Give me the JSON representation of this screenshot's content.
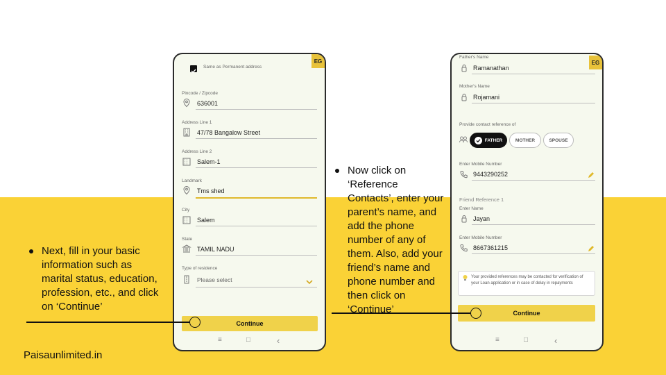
{
  "slide": {
    "left_note": "Next, fill in your basic information such as marital status, education, profession, etc., and click on ‘Continue’",
    "right_note": "Now click on ‘Reference Contacts’, enter your parent’s name, and add the phone number of any of them. Also, add your friend’s name and phone number and then click on ‘Continue’",
    "brand": "Paisaunlimited.in"
  },
  "phone1": {
    "badge": "EG",
    "checkbox_label": "Same as Permanent address",
    "fields": [
      {
        "label": "Pincode / Zipcode",
        "value": "636001",
        "icon": "location-pin-icon"
      },
      {
        "label": "Address Line 1",
        "value": "47/78 Bangalow Street",
        "icon": "building-icon"
      },
      {
        "label": "Address Line 2",
        "value": "Salem-1",
        "icon": "building-icon"
      },
      {
        "label": "Landmark",
        "value": "Tms shed",
        "icon": "location-pin-icon"
      },
      {
        "label": "City",
        "value": "Salem",
        "icon": "building-icon"
      },
      {
        "label": "State",
        "value": "TAMIL NADU",
        "icon": "bank-icon"
      }
    ],
    "residence_label": "Type of residence",
    "residence_placeholder": "Please select",
    "continue_label": "Continue"
  },
  "phone2": {
    "badge": "EG",
    "fathers_name_label": "Father's Name",
    "fathers_name": "Ramanathan",
    "mothers_name_label": "Mother's Name",
    "mothers_name": "Rojamani",
    "contact_ref_label": "Provide contact reference of",
    "relations": [
      "FATHER",
      "MOTHER",
      "SPOUSE"
    ],
    "mobile_label": "Enter Mobile Number",
    "mobile_value": "9443290252",
    "friend_ref_title": "Friend Reference 1",
    "friend_name_label": "Enter Name",
    "friend_name": "Jayan",
    "friend_mobile_label": "Enter Mobile Number",
    "friend_mobile": "8667361215",
    "info_text": "Your provided references may be contacted for verification of your Loan application or in case of delay in repayments",
    "continue_label": "Continue"
  },
  "nav": {
    "menu": "≡",
    "home": "□",
    "back": "‹"
  },
  "colors": {
    "band": "#fad236",
    "button": "#f0d24a",
    "active_pill": "#111111"
  }
}
